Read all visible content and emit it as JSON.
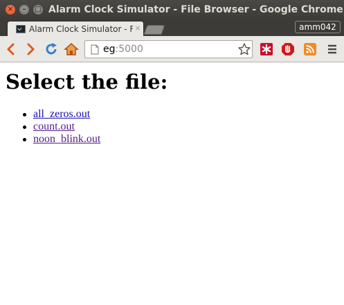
{
  "window": {
    "title": "Alarm Clock Simulator - File Browser - Google Chrome"
  },
  "tabs": [
    {
      "title": "Alarm Clock Simulator - File Browser",
      "close": "×"
    }
  ],
  "profile": {
    "name": "amm042"
  },
  "toolbar": {
    "url_host": "eg",
    "url_port": ":5000"
  },
  "page": {
    "heading": "Select the file:",
    "files": [
      {
        "name": "all_zeros.out"
      },
      {
        "name": "count.out"
      },
      {
        "name": "noon_blink.out"
      }
    ]
  },
  "colors": {
    "link": "#1a0dab",
    "visited_link": "#551a8b",
    "titlebar": "#3c3b37",
    "toolbar": "#e9e8e4"
  }
}
